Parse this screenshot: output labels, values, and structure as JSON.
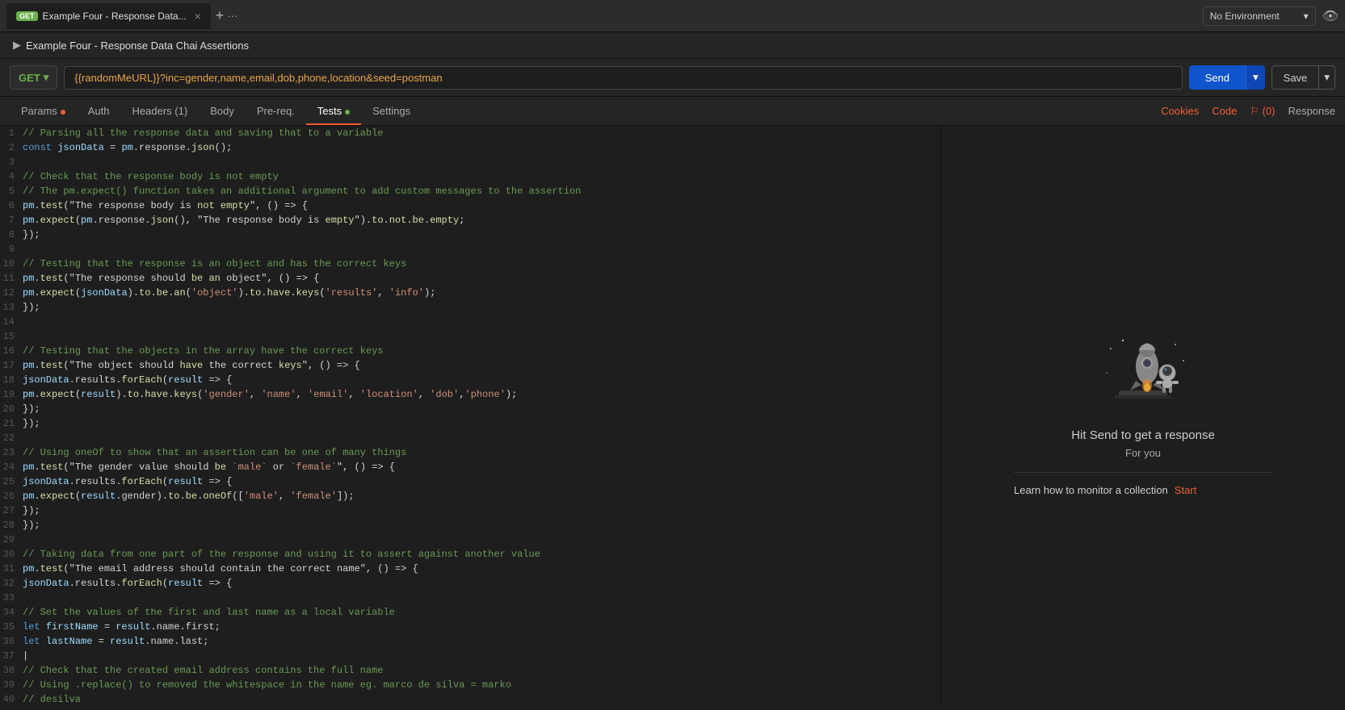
{
  "topBar": {
    "tab": {
      "method": "GET",
      "title": "Example Four - Response Data...",
      "closeLabel": "×",
      "addLabel": "+",
      "moreLabel": "···"
    },
    "envSelect": {
      "label": "No Environment",
      "chevron": "▾"
    },
    "eyeIcon": "👁"
  },
  "requestTitleBar": {
    "collapseIcon": "▶",
    "title": "Example Four - Response Data Chai Assertions"
  },
  "urlBar": {
    "method": "GET",
    "methodChevron": "▾",
    "url": "{{randomMeURL}}?inc=gender,name,email,dob,phone,location&seed=postman",
    "sendLabel": "Send",
    "sendChevron": "▾",
    "saveLabel": "Save",
    "saveChevron": "▾"
  },
  "tabsNav": {
    "items": [
      {
        "id": "params",
        "label": "Params",
        "dot": "orange",
        "active": false
      },
      {
        "id": "auth",
        "label": "Auth",
        "dot": null,
        "active": false
      },
      {
        "id": "headers",
        "label": "Headers (1)",
        "dot": null,
        "active": false
      },
      {
        "id": "body",
        "label": "Body",
        "dot": null,
        "active": false
      },
      {
        "id": "prereq",
        "label": "Pre-req.",
        "dot": null,
        "active": false
      },
      {
        "id": "tests",
        "label": "Tests",
        "dot": "green",
        "active": true
      },
      {
        "id": "settings",
        "label": "Settings",
        "dot": null,
        "active": false
      }
    ],
    "right": {
      "cookies": "Cookies",
      "code": "Code",
      "comments": "⚐ (0)",
      "response": "Response"
    }
  },
  "codeEditor": {
    "lines": [
      {
        "num": 1,
        "text": "// Parsing all the response data and saving that to a variable",
        "type": "comment"
      },
      {
        "num": 2,
        "text": "const jsonData = pm.response.json();",
        "type": "code"
      },
      {
        "num": 3,
        "text": "",
        "type": "blank"
      },
      {
        "num": 4,
        "text": "// Check that the response body is not empty",
        "type": "comment"
      },
      {
        "num": 5,
        "text": "// The pm.expect() function takes an additional argument to add custom messages to the assertion",
        "type": "comment"
      },
      {
        "num": 6,
        "text": "pm.test(\"The response body is not empty\", () => {",
        "type": "code"
      },
      {
        "num": 7,
        "text": "    pm.expect(pm.response.json(), \"The response body is empty\").to.not.be.empty;",
        "type": "code"
      },
      {
        "num": 8,
        "text": "});",
        "type": "code"
      },
      {
        "num": 9,
        "text": "",
        "type": "blank"
      },
      {
        "num": 10,
        "text": "// Testing that the response is an object and has the correct keys",
        "type": "comment"
      },
      {
        "num": 11,
        "text": "pm.test(\"The response should be an object\", () => {",
        "type": "code"
      },
      {
        "num": 12,
        "text": "    pm.expect(jsonData).to.be.an('object').to.have.keys('results', 'info');",
        "type": "code"
      },
      {
        "num": 13,
        "text": "});",
        "type": "code"
      },
      {
        "num": 14,
        "text": "",
        "type": "blank"
      },
      {
        "num": 15,
        "text": "",
        "type": "blank"
      },
      {
        "num": 16,
        "text": "// Testing that the objects in the array have the correct keys",
        "type": "comment"
      },
      {
        "num": 17,
        "text": "pm.test(\"The object should have the correct keys\", () => {",
        "type": "code"
      },
      {
        "num": 18,
        "text": "    jsonData.results.forEach(result => {",
        "type": "code"
      },
      {
        "num": 19,
        "text": "        pm.expect(result).to.have.keys('gender', 'name', 'email', 'location', 'dob','phone');",
        "type": "code"
      },
      {
        "num": 20,
        "text": "    });",
        "type": "code"
      },
      {
        "num": 21,
        "text": "});",
        "type": "code"
      },
      {
        "num": 22,
        "text": "",
        "type": "blank"
      },
      {
        "num": 23,
        "text": "// Using oneOf to show that an assertion can be one of many things",
        "type": "comment"
      },
      {
        "num": 24,
        "text": "pm.test(\"The gender value should be `male` or `female`\", () => {",
        "type": "code"
      },
      {
        "num": 25,
        "text": "    jsonData.results.forEach(result => {",
        "type": "code"
      },
      {
        "num": 26,
        "text": "        pm.expect(result.gender).to.be.oneOf(['male', 'female']);",
        "type": "code"
      },
      {
        "num": 27,
        "text": "    });",
        "type": "code"
      },
      {
        "num": 28,
        "text": "});",
        "type": "code"
      },
      {
        "num": 29,
        "text": "",
        "type": "blank"
      },
      {
        "num": 30,
        "text": "// Taking data from one part of the response and using it to assert against another value",
        "type": "comment"
      },
      {
        "num": 31,
        "text": "pm.test(\"The email address should contain the correct name\", () => {",
        "type": "code"
      },
      {
        "num": 32,
        "text": "    jsonData.results.forEach(result => {",
        "type": "code"
      },
      {
        "num": 33,
        "text": "",
        "type": "blank"
      },
      {
        "num": 34,
        "text": "        // Set the values of the first and last name as a local variable",
        "type": "comment"
      },
      {
        "num": 35,
        "text": "        let firstName = result.name.first;",
        "type": "code"
      },
      {
        "num": 36,
        "text": "        let lastName = result.name.last;",
        "type": "code"
      },
      {
        "num": 37,
        "text": "        |",
        "type": "cursor"
      },
      {
        "num": 38,
        "text": "        // Check that the created email address contains the full name",
        "type": "comment"
      },
      {
        "num": 39,
        "text": "        // Using .replace() to removed the whitespace in the name eg. marco de silva = marko",
        "type": "comment"
      },
      {
        "num": 40,
        "text": "        //                                                                          desilva",
        "type": "comment"
      }
    ]
  },
  "responsePanel": {
    "illustrationAlt": "rocket illustration",
    "title": "Hit Send to get a response",
    "subtitle": "For you",
    "monitorText": "Learn how to monitor a collection",
    "startLabel": "Start"
  }
}
